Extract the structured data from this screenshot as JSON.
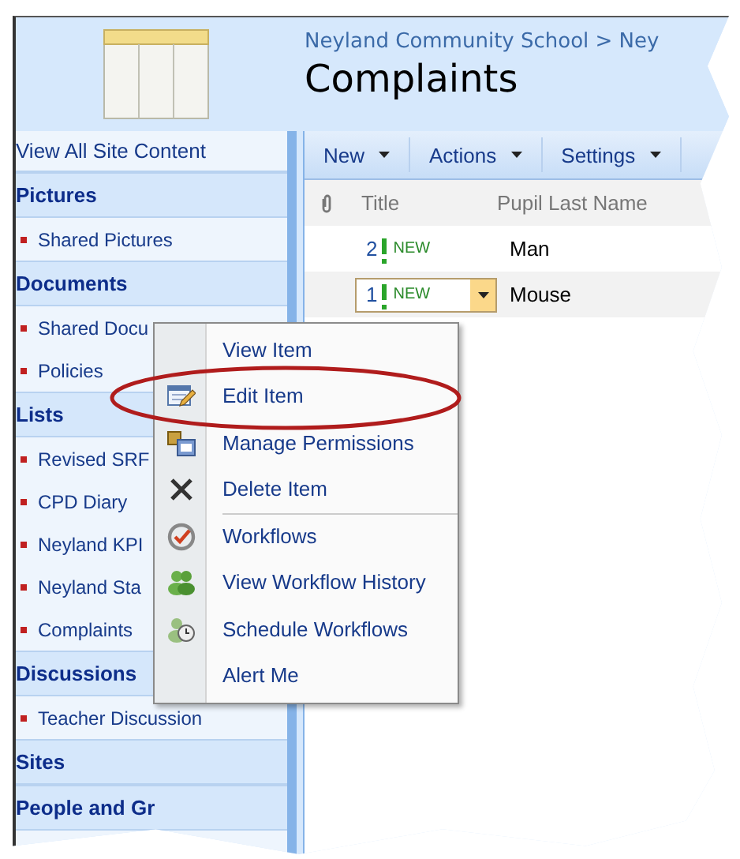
{
  "breadcrumb": "Neyland Community School > Ney",
  "title": "Complaints",
  "sidebar": [
    {
      "kind": "link",
      "label": "View All Site Content"
    },
    {
      "kind": "heading",
      "label": "Pictures"
    },
    {
      "kind": "item",
      "label": "Shared Pictures"
    },
    {
      "kind": "heading",
      "label": "Documents"
    },
    {
      "kind": "item",
      "label": "Shared Docu"
    },
    {
      "kind": "item",
      "label": "Policies"
    },
    {
      "kind": "heading",
      "label": "Lists"
    },
    {
      "kind": "item",
      "label": "Revised SRF"
    },
    {
      "kind": "item",
      "label": "CPD Diary"
    },
    {
      "kind": "item",
      "label": "Neyland KPI"
    },
    {
      "kind": "item",
      "label": "Neyland Sta"
    },
    {
      "kind": "item",
      "label": "Complaints"
    },
    {
      "kind": "heading",
      "label": "Discussions"
    },
    {
      "kind": "item",
      "label": "Teacher Discussion"
    },
    {
      "kind": "heading",
      "label": "Sites"
    },
    {
      "kind": "heading",
      "label": "People and Gr"
    }
  ],
  "toolbar": [
    "New",
    "Actions",
    "Settings"
  ],
  "columns": [
    "Title",
    "Pupil Last Name"
  ],
  "rows": [
    {
      "title": "2",
      "badge": "NEW",
      "last_name": "Man",
      "selected": false
    },
    {
      "title": "1",
      "badge": "NEW",
      "last_name": "Mouse",
      "selected": true
    }
  ],
  "context_menu": [
    {
      "label": "View Item",
      "divider_before": false,
      "circled": false
    },
    {
      "label": "Edit Item",
      "divider_before": false,
      "circled": true
    },
    {
      "label": "Manage Permissions",
      "divider_before": false,
      "circled": false
    },
    {
      "label": "Delete Item",
      "divider_before": false,
      "circled": false
    },
    {
      "label": "Workflows",
      "divider_before": true,
      "circled": false
    },
    {
      "label": "View Workflow History",
      "divider_before": false,
      "circled": false
    },
    {
      "label": "Schedule Workflows",
      "divider_before": false,
      "circled": false
    },
    {
      "label": "Alert Me",
      "divider_before": false,
      "circled": false
    }
  ]
}
